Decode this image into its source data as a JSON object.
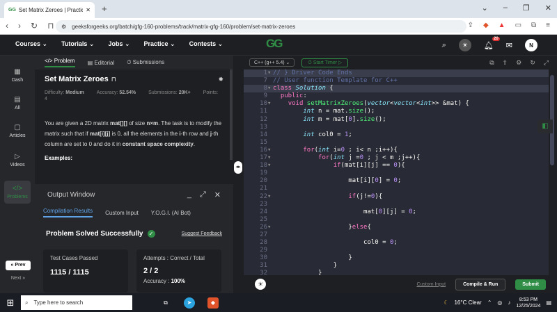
{
  "browser": {
    "tab_title": "Set Matrix Zeroes | Practice | G",
    "favicon": "GG",
    "new_tab": "+",
    "url": "geeksforgeeks.org/batch/gfg-160-problems/track/matrix-gfg-160/problem/set-matrix-zeroes"
  },
  "header": {
    "nav": [
      "Courses",
      "Tutorials",
      "Jobs",
      "Practice",
      "Contests"
    ],
    "logo": "GG",
    "notif_count": "20",
    "avatar": "N"
  },
  "rail": {
    "items": [
      "Dash",
      "All",
      "Articles",
      "Videos",
      "Problems"
    ],
    "prev": "« Prev",
    "next": "Next »"
  },
  "problem": {
    "tabs": [
      "</> Problem",
      "Editorial",
      "Submissions"
    ],
    "title": "Set Matrix Zeroes",
    "difficulty_label": "Difficulty:",
    "difficulty": "Medium",
    "accuracy_label": "Accuracy:",
    "accuracy": "52.54%",
    "submissions_label": "Submissions:",
    "submissions": "20K+",
    "points_label": "Points:",
    "points": "4",
    "description_parts": [
      "You are given a 2D matrix ",
      "mat[][]",
      " of size ",
      "n×m",
      ". The task is to modify the matrix such that if ",
      "mat[i][j]",
      " is 0, all the elements in the ",
      "i",
      "-th row and ",
      "j",
      "-th column are set to 0 and do it in ",
      "constant space complexity",
      "."
    ],
    "examples_label": "Examples:"
  },
  "output": {
    "title": "Output Window",
    "tabs": [
      "Compilation Results",
      "Custom Input",
      "Y.O.G.I. (AI Bot)"
    ],
    "status": "Problem Solved Successfully",
    "suggest_feedback": "Suggest Feedback",
    "test_cases_label": "Test Cases Passed",
    "test_cases": "1115 / 1115",
    "attempts_label": "Attempts : Correct / Total",
    "attempts": "2 / 2",
    "accuracy_label": "Accuracy :",
    "accuracy": "100%"
  },
  "editor": {
    "language": "C++ (g++ 5.4)",
    "timer": "Start Timer",
    "custom_input": "Custom Input",
    "compile_run": "Compile & Run",
    "submit": "Submit",
    "lines": [
      {
        "n": "1",
        "fold": true,
        "text": "// } Driver Code Ends",
        "hl": true
      },
      {
        "n": "7",
        "fold": false,
        "text": "// User function Template for C++"
      },
      {
        "n": "8",
        "fold": true,
        "text": "class Solution {",
        "hl": true
      },
      {
        "n": "9",
        "fold": false,
        "text": "  public:"
      },
      {
        "n": "10",
        "fold": true,
        "text": "    void setMatrixZeroes(vector<vector<int>> &mat) {"
      },
      {
        "n": "11",
        "fold": false,
        "text": "        int n = mat.size();"
      },
      {
        "n": "12",
        "fold": false,
        "text": "        int m = mat[0].size();"
      },
      {
        "n": "13",
        "fold": false,
        "text": ""
      },
      {
        "n": "14",
        "fold": false,
        "text": "        int col0 = 1;"
      },
      {
        "n": "15",
        "fold": false,
        "text": ""
      },
      {
        "n": "16",
        "fold": true,
        "text": "        for(int i=0 ; i< n ;i++){"
      },
      {
        "n": "17",
        "fold": true,
        "text": "            for(int j =0 ; j < m ;j++){"
      },
      {
        "n": "18",
        "fold": true,
        "text": "                if(mat[i][j] == 0){"
      },
      {
        "n": "19",
        "fold": false,
        "text": ""
      },
      {
        "n": "20",
        "fold": false,
        "text": "                    mat[i][0] = 0;"
      },
      {
        "n": "21",
        "fold": false,
        "text": ""
      },
      {
        "n": "22",
        "fold": true,
        "text": "                    if(j!=0){"
      },
      {
        "n": "23",
        "fold": false,
        "text": ""
      },
      {
        "n": "24",
        "fold": false,
        "text": "                        mat[0][j] = 0;"
      },
      {
        "n": "25",
        "fold": false,
        "text": ""
      },
      {
        "n": "26",
        "fold": true,
        "text": "                    }else{"
      },
      {
        "n": "27",
        "fold": false,
        "text": ""
      },
      {
        "n": "28",
        "fold": false,
        "text": "                        col0 = 0;"
      },
      {
        "n": "29",
        "fold": false,
        "text": ""
      },
      {
        "n": "30",
        "fold": false,
        "text": "                    }"
      },
      {
        "n": "31",
        "fold": false,
        "text": "                }"
      },
      {
        "n": "32",
        "fold": false,
        "text": "            }"
      }
    ]
  },
  "taskbar": {
    "search_placeholder": "Type here to search",
    "weather": "16°C  Clear",
    "time": "8:53 PM",
    "date": "12/25/2024"
  },
  "colors": {
    "accent": "#2f8d46",
    "editor_bg": "#282a36",
    "tab_blue": "#5fa3e6"
  }
}
